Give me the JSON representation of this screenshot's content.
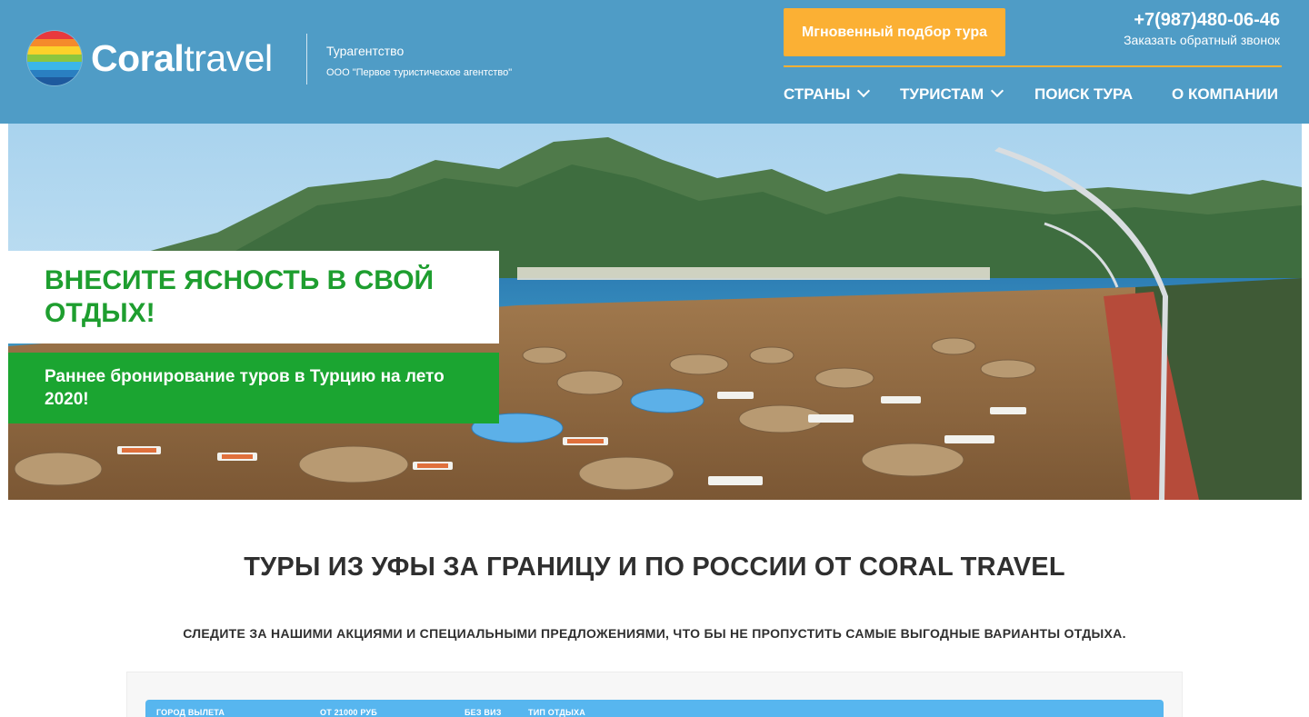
{
  "header": {
    "logo": {
      "bold": "Coral",
      "light": "travel"
    },
    "agency_type": "Турагентство",
    "agency_name": "ООО \"Первое туристическое агентство\"",
    "cta_button": "Мгновенный подбор тура",
    "phone": "+7(987)480-06-46",
    "callback": "Заказать обратный звонок",
    "nav": [
      {
        "label": "СТРАНЫ",
        "has_dropdown": true
      },
      {
        "label": "ТУРИСТАМ",
        "has_dropdown": true
      },
      {
        "label": "ПОИСК ТУРА",
        "has_dropdown": false
      },
      {
        "label": "О КОМПАНИИ",
        "has_dropdown": false
      }
    ]
  },
  "hero": {
    "title": "ВНЕСИТЕ ЯСНОСТЬ В СВОЙ ОТДЫХ!",
    "subtitle": "Раннее бронирование туров в Турцию на лето 2020!"
  },
  "main": {
    "title": "ТУРЫ ИЗ УФЫ ЗА ГРАНИЦУ И ПО РОССИИ ОТ CORAL TRAVEL",
    "subtitle": "СЛЕДИТЕ ЗА НАШИМИ АКЦИЯМИ И СПЕЦИАЛЬНЫМИ ПРЕДЛОЖЕНИЯМИ, ЧТО БЫ НЕ ПРОПУСТИТЬ САМЫЕ ВЫГОДНЫЕ ВАРИАНТЫ ОТДЫХА."
  },
  "search": {
    "fields": [
      "ГОРОД ВЫЛЕТА",
      "ОТ 21000 РУБ",
      "БЕЗ ВИЗ",
      "ТИП ОТДЫХА"
    ]
  },
  "colors": {
    "header_bg": "#4f9cc6",
    "accent_orange": "#fbb034",
    "brand_green": "#1ba531",
    "title_green": "#1e9e2f",
    "search_blue": "#57b6ef"
  }
}
